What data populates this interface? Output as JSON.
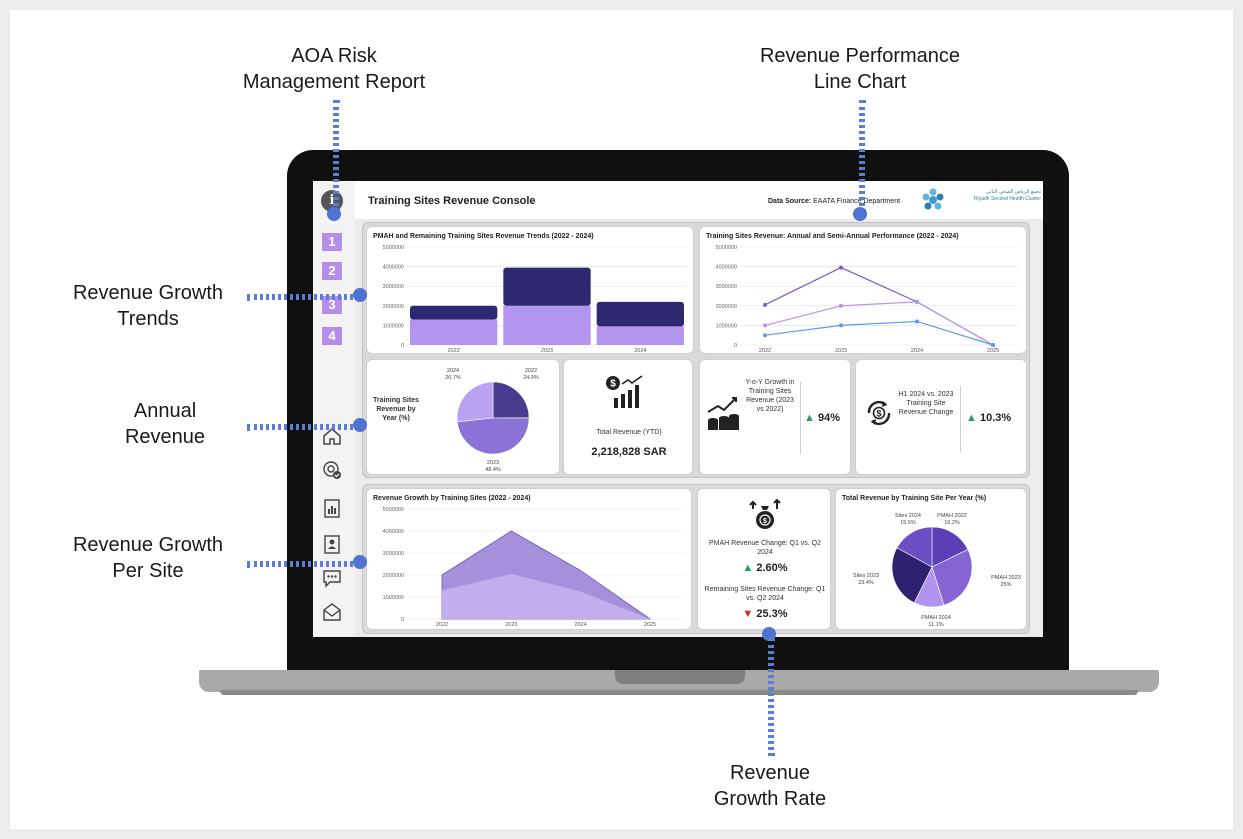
{
  "callouts": {
    "aoa": [
      "AOA Risk",
      "Management Report"
    ],
    "revenue_line": [
      "Revenue Performance",
      "Line Chart"
    ],
    "growth_trends": [
      "Revenue Growth",
      "Trends"
    ],
    "annual": [
      "Annual",
      "Revenue"
    ],
    "per_site": [
      "Revenue Growth",
      "Per Site"
    ],
    "growth_rate": [
      "Revenue",
      "Growth Rate"
    ]
  },
  "colors": {
    "accent": "#4f73d1",
    "dark_purple": "#2e2870",
    "mid_purple": "#7c5cc9",
    "light_purple": "#b394ee",
    "blue": "#5b9de8"
  },
  "sidebar": {
    "info_icon": "i",
    "sections": [
      "1",
      "2",
      "3",
      "4"
    ],
    "icons": [
      "home-icon",
      "target-check-icon",
      "report-icon",
      "contact-icon",
      "chat-icon",
      "mail-icon"
    ]
  },
  "header": {
    "title": "Training Sites Revenue Console",
    "data_source_label": "Data Source:",
    "data_source_value": "EAATA Finance Department",
    "logo_ar": "تجمع الرياض الصحي الثاني",
    "logo_en": "Riyadh Second Health Cluster"
  },
  "bar_chart": {
    "title": "PMAH and Remaining Training Sites Revenue Trends (2022 - 2024)",
    "chart_data": {
      "type": "bar",
      "stacked": true,
      "categories": [
        "2022",
        "2023",
        "2024"
      ],
      "series": [
        {
          "values": [
            1300000,
            2000000,
            950000
          ]
        },
        {
          "values": [
            700000,
            1950000,
            1250000
          ]
        }
      ],
      "ylim": [
        0,
        5000000
      ],
      "yticks": [
        "5000000",
        "4000000",
        "3000000",
        "2000000",
        "1000000",
        "0"
      ]
    }
  },
  "line_chart": {
    "title": "Training Sites Revenue: Annual and Semi-Annual Performance (2022 - 2024)",
    "chart_data": {
      "type": "line",
      "x": [
        "2022",
        "2023",
        "2024",
        "2025"
      ],
      "series": [
        {
          "values": [
            2050000,
            3950000,
            2200000,
            0
          ]
        },
        {
          "values": [
            1000000,
            2000000,
            2200000,
            0
          ]
        },
        {
          "values": [
            500000,
            1000000,
            1200000,
            0
          ]
        }
      ],
      "ylim": [
        0,
        5000000
      ],
      "yticks": [
        "5000000",
        "4000000",
        "3000000",
        "2000000",
        "1000000",
        "0"
      ]
    }
  },
  "pie_year": {
    "label": "Training Sites Revenue by Year (%)",
    "chart_data": {
      "type": "pie",
      "slices": [
        {
          "name": "2022",
          "pct_label": "24.9%",
          "value": 24.9
        },
        {
          "name": "2023",
          "pct_label": "48.4%",
          "value": 48.4
        },
        {
          "name": "2024",
          "pct_label": "26.7%",
          "value": 26.7
        }
      ]
    }
  },
  "kpi_total": {
    "label": "Total Revenue (YTD)",
    "value": "2,218,828 SAR"
  },
  "kpi_yoy": {
    "label": "Y-o-Y Growth in Training Sites Revenue (2023 vs 2022)",
    "value": "94%"
  },
  "kpi_h1": {
    "label": "H1 2024 vs. 2023 Training Site Revenue Change",
    "value": "10.3%"
  },
  "area_chart": {
    "title": "Revenue Growth by Training Sites (2022 - 2024)",
    "chart_data": {
      "type": "area",
      "x": [
        "2022",
        "2023",
        "2024",
        "2025"
      ],
      "series": [
        {
          "values": [
            2000000,
            4000000,
            2200000,
            0
          ]
        },
        {
          "values": [
            1300000,
            2050000,
            1250000,
            0
          ]
        }
      ],
      "ylim": [
        0,
        5000000
      ],
      "yticks": [
        "5000000",
        "4000000",
        "3000000",
        "2000000",
        "1000000",
        "0"
      ]
    }
  },
  "kpi_quarter": {
    "pmah_label": "PMAH Revenue Change: Q1 vs. Q2 2024",
    "pmah_value": "2.60%",
    "remaining_label": "Remaining Sites Revenue Change: Q1 vs. Q2 2024",
    "remaining_value": "25.3%"
  },
  "pie_site": {
    "title": "Total Revenue by Training Site Per Year (%)",
    "chart_data": {
      "type": "pie",
      "slices": [
        {
          "name": "PMAH 2022",
          "pct_label": "16.2%",
          "value": 16.2
        },
        {
          "name": "PMAH 2023",
          "pct_label": "25%",
          "value": 25
        },
        {
          "name": "PMAH 2024",
          "pct_label": "11.1%",
          "value": 11.1
        },
        {
          "name": "Sites 2023",
          "pct_label": "23.4%",
          "value": 23.4
        },
        {
          "name": "Sites 2024",
          "pct_label": "15.5%",
          "value": 15.5
        }
      ]
    }
  }
}
